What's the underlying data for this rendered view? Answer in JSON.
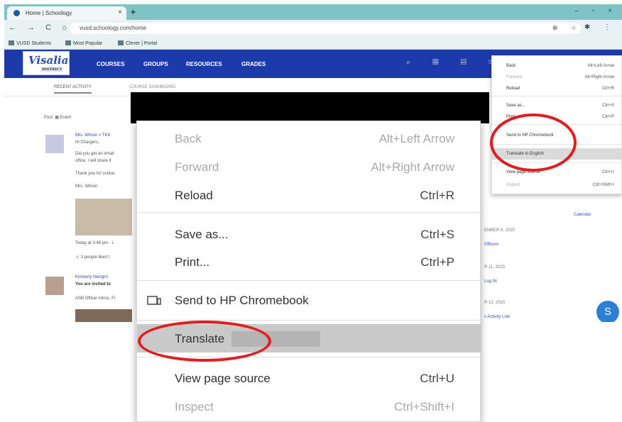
{
  "browser": {
    "tab_title": "Home | Schoology",
    "tab_close": "×",
    "new_tab": "+",
    "window_controls": "– ▫ ×",
    "nav_controls": "← → C ⌂",
    "url": "vusd.schoology.com/home",
    "omnibox_icons": "⊕ ☆",
    "toolbar_right": "✱ ⋮",
    "bookmarks": [
      "VUSD Students",
      "Most Popular",
      "Clever | Portal"
    ]
  },
  "site": {
    "logo_text": "Visalia",
    "logo_sub": "DISTRICT",
    "nav": [
      "COURSES",
      "GROUPS",
      "RESOURCES",
      "GRADES"
    ],
    "header_icons": "⌕ ▦ ▤ ✉",
    "subtabs": [
      "RECENT ACTIVITY",
      "COURSE DASHBOARD"
    ],
    "feed_lines": [
      "Post: ▦ Event",
      "Mrs. Wilson » TK8",
      "Hi Chargers,",
      "Did you get an email",
      "office. I will share it",
      "Thank you for contac",
      "Mrs. Wilson",
      "Today at 3:48 pm · L",
      "☺ 3 people liked t",
      "Kimberly Mangini",
      "You are invited to",
      "ASB Officer Intros, Fr"
    ],
    "sidebar_lines": [
      "Calendar",
      "EMBER 8, 2020",
      "Officers",
      "R 11, 2020",
      "Log IN",
      "R 12, 2020",
      "s Activity Link"
    ],
    "avatar_letter": "S"
  },
  "small_menu": {
    "items": [
      {
        "label": "Back",
        "shortcut": "Alt+Left Arrow",
        "disabled": false
      },
      {
        "label": "Forward",
        "shortcut": "Alt+Right Arrow",
        "disabled": true
      },
      {
        "label": "Reload",
        "shortcut": "Ctrl+R",
        "disabled": false
      },
      {
        "label": "Save as...",
        "shortcut": "Ctrl+S",
        "disabled": false
      },
      {
        "label": "Print...",
        "shortcut": "Ctrl+P",
        "disabled": false
      },
      {
        "label": "Send to HP Chromebook",
        "shortcut": "",
        "disabled": false
      },
      {
        "label": "Translate to English",
        "shortcut": "",
        "disabled": false
      },
      {
        "label": "View page source",
        "shortcut": "Ctrl+U",
        "disabled": false
      },
      {
        "label": "Inspect",
        "shortcut": "Ctrl+Shift+I",
        "disabled": true
      }
    ]
  },
  "big_menu": {
    "items": [
      {
        "label": "Back",
        "shortcut": "Alt+Left Arrow",
        "disabled": true
      },
      {
        "label": "Forward",
        "shortcut": "Alt+Right Arrow",
        "disabled": true
      },
      {
        "label": "Reload",
        "shortcut": "Ctrl+R",
        "disabled": false
      },
      {
        "label": "Save as...",
        "shortcut": "Ctrl+S",
        "disabled": false
      },
      {
        "label": "Print...",
        "shortcut": "Ctrl+P",
        "disabled": false
      },
      {
        "label": "Send to HP Chromebook",
        "shortcut": "",
        "disabled": false
      },
      {
        "label": "Translate",
        "shortcut": "",
        "disabled": false
      },
      {
        "label": "View page source",
        "shortcut": "Ctrl+U",
        "disabled": false
      },
      {
        "label": "Inspect",
        "shortcut": "Ctrl+Shift+I",
        "disabled": true
      }
    ]
  },
  "colors": {
    "annotation_red": "#e21d1d",
    "site_header": "#1c3aa9",
    "tabstrip": "#7fc3c6",
    "highlight": "#c9c9c9"
  },
  "icons": {
    "cast": "cast-icon",
    "favicon": "schoology-favicon"
  }
}
